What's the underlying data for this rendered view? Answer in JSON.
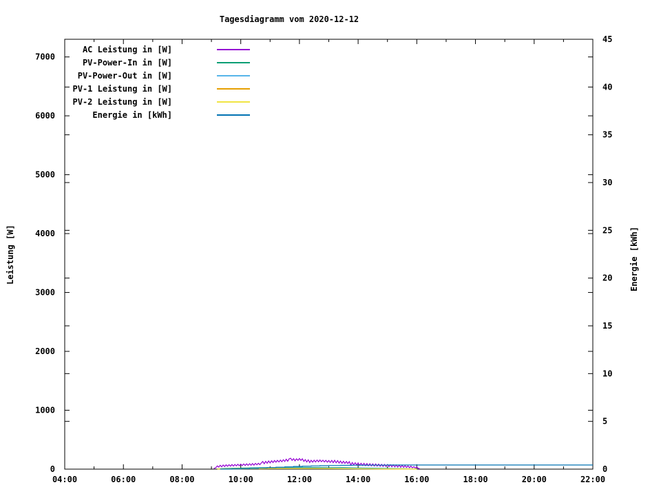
{
  "window": {
    "background": "#ffffff",
    "foreground": "#000000"
  },
  "chart_data": {
    "type": "line",
    "title": "Tagesdiagramm vom 2020-12-12",
    "xlabel": "",
    "ylabel": "Leistung [W]",
    "y2label": "Energie [kWh]",
    "x_axis": {
      "unit": "time",
      "range_hours": [
        4,
        22
      ],
      "major_tick_hours": [
        4,
        6,
        8,
        10,
        12,
        14,
        16,
        18,
        20,
        22
      ],
      "major_tick_labels": [
        "04:00",
        "06:00",
        "08:00",
        "10:00",
        "12:00",
        "14:00",
        "16:00",
        "18:00",
        "20:00",
        "22:00"
      ],
      "minor_tick_hours": [
        5,
        7,
        9,
        11,
        13,
        15,
        17,
        19,
        21
      ]
    },
    "y_axis": {
      "label": "Leistung [W]",
      "range": [
        0,
        7300
      ],
      "ticks": [
        0,
        1000,
        2000,
        3000,
        4000,
        5000,
        6000,
        7000
      ],
      "tick_labels": [
        "0",
        "1000",
        "2000",
        "3000",
        "4000",
        "5000",
        "6000",
        "7000"
      ]
    },
    "y2_axis": {
      "label": "Energie [kWh]",
      "range": [
        0,
        45
      ],
      "ticks": [
        0,
        5,
        10,
        15,
        20,
        25,
        30,
        35,
        40,
        45
      ],
      "tick_labels": [
        "0",
        "5",
        "10",
        "15",
        "20",
        "25",
        "30",
        "35",
        "40",
        "45"
      ]
    },
    "legend": {
      "position": "top-left-inside",
      "rows": 6
    },
    "grid": false,
    "series": [
      {
        "name": "AC Leistung in [W]",
        "color": "#9400d3",
        "axis": "y1",
        "style": "lines",
        "points": [
          [
            9.08,
            10
          ],
          [
            9.15,
            25
          ],
          [
            9.2,
            55
          ],
          [
            9.25,
            35
          ],
          [
            9.3,
            65
          ],
          [
            9.35,
            40
          ],
          [
            9.4,
            70
          ],
          [
            9.45,
            45
          ],
          [
            9.5,
            72
          ],
          [
            9.55,
            48
          ],
          [
            9.6,
            75
          ],
          [
            9.65,
            50
          ],
          [
            9.7,
            78
          ],
          [
            9.75,
            52
          ],
          [
            9.8,
            80
          ],
          [
            9.85,
            55
          ],
          [
            9.9,
            82
          ],
          [
            9.95,
            58
          ],
          [
            10.0,
            85
          ],
          [
            10.05,
            60
          ],
          [
            10.1,
            88
          ],
          [
            10.15,
            62
          ],
          [
            10.2,
            90
          ],
          [
            10.25,
            64
          ],
          [
            10.3,
            92
          ],
          [
            10.35,
            66
          ],
          [
            10.4,
            95
          ],
          [
            10.45,
            68
          ],
          [
            10.5,
            98
          ],
          [
            10.55,
            72
          ],
          [
            10.6,
            100
          ],
          [
            10.65,
            76
          ],
          [
            10.7,
            105
          ],
          [
            10.75,
            130
          ],
          [
            10.8,
            92
          ],
          [
            10.85,
            132
          ],
          [
            10.9,
            100
          ],
          [
            10.95,
            138
          ],
          [
            11.0,
            105
          ],
          [
            11.05,
            142
          ],
          [
            11.1,
            112
          ],
          [
            11.15,
            146
          ],
          [
            11.2,
            118
          ],
          [
            11.25,
            150
          ],
          [
            11.3,
            122
          ],
          [
            11.35,
            155
          ],
          [
            11.4,
            125
          ],
          [
            11.45,
            160
          ],
          [
            11.5,
            130
          ],
          [
            11.55,
            168
          ],
          [
            11.6,
            135
          ],
          [
            11.65,
            176
          ],
          [
            11.7,
            185
          ],
          [
            11.75,
            148
          ],
          [
            11.8,
            178
          ],
          [
            11.85,
            142
          ],
          [
            11.9,
            175
          ],
          [
            11.95,
            150
          ],
          [
            12.0,
            180
          ],
          [
            12.05,
            148
          ],
          [
            12.1,
            176
          ],
          [
            12.15,
            132
          ],
          [
            12.2,
            162
          ],
          [
            12.25,
            120
          ],
          [
            12.3,
            158
          ],
          [
            12.35,
            112
          ],
          [
            12.4,
            150
          ],
          [
            12.45,
            118
          ],
          [
            12.5,
            152
          ],
          [
            12.55,
            122
          ],
          [
            12.6,
            155
          ],
          [
            12.65,
            124
          ],
          [
            12.7,
            156
          ],
          [
            12.75,
            126
          ],
          [
            12.8,
            152
          ],
          [
            12.85,
            122
          ],
          [
            12.9,
            150
          ],
          [
            12.95,
            118
          ],
          [
            13.0,
            146
          ],
          [
            13.05,
            114
          ],
          [
            13.1,
            148
          ],
          [
            13.15,
            110
          ],
          [
            13.2,
            150
          ],
          [
            13.25,
            108
          ],
          [
            13.3,
            145
          ],
          [
            13.35,
            104
          ],
          [
            13.4,
            138
          ],
          [
            13.45,
            100
          ],
          [
            13.5,
            135
          ],
          [
            13.55,
            98
          ],
          [
            13.6,
            130
          ],
          [
            13.65,
            95
          ],
          [
            13.7,
            128
          ],
          [
            13.75,
            68
          ],
          [
            13.8,
            112
          ],
          [
            13.85,
            74
          ],
          [
            13.9,
            108
          ],
          [
            13.95,
            70
          ],
          [
            14.0,
            105
          ],
          [
            14.05,
            66
          ],
          [
            14.1,
            100
          ],
          [
            14.15,
            62
          ],
          [
            14.2,
            98
          ],
          [
            14.25,
            58
          ],
          [
            14.3,
            95
          ],
          [
            14.35,
            56
          ],
          [
            14.4,
            92
          ],
          [
            14.45,
            54
          ],
          [
            14.5,
            90
          ],
          [
            14.55,
            52
          ],
          [
            14.6,
            88
          ],
          [
            14.65,
            50
          ],
          [
            14.7,
            85
          ],
          [
            14.75,
            48
          ],
          [
            14.8,
            82
          ],
          [
            14.85,
            46
          ],
          [
            14.9,
            80
          ],
          [
            14.95,
            44
          ],
          [
            15.0,
            78
          ],
          [
            15.05,
            42
          ],
          [
            15.1,
            75
          ],
          [
            15.15,
            40
          ],
          [
            15.2,
            72
          ],
          [
            15.25,
            38
          ],
          [
            15.3,
            70
          ],
          [
            15.35,
            35
          ],
          [
            15.4,
            68
          ],
          [
            15.45,
            32
          ],
          [
            15.5,
            65
          ],
          [
            15.55,
            30
          ],
          [
            15.6,
            60
          ],
          [
            15.65,
            28
          ],
          [
            15.7,
            55
          ],
          [
            15.75,
            25
          ],
          [
            15.8,
            50
          ],
          [
            15.85,
            22
          ],
          [
            15.9,
            42
          ],
          [
            15.95,
            18
          ],
          [
            16.0,
            35
          ],
          [
            16.05,
            14
          ],
          [
            16.1,
            5
          ]
        ]
      },
      {
        "name": "PV-Power-In in [W]",
        "color": "#009e73",
        "axis": "y1",
        "style": "lines",
        "points": [
          [
            9.2,
            5
          ],
          [
            9.5,
            12
          ],
          [
            10.0,
            18
          ],
          [
            10.5,
            22
          ],
          [
            11.0,
            25
          ],
          [
            11.5,
            28
          ],
          [
            12.0,
            30
          ],
          [
            12.5,
            28
          ],
          [
            13.0,
            26
          ],
          [
            13.5,
            24
          ],
          [
            14.0,
            20
          ],
          [
            14.5,
            16
          ],
          [
            15.0,
            12
          ],
          [
            15.5,
            8
          ],
          [
            16.0,
            4
          ]
        ]
      },
      {
        "name": "PV-Power-Out in [W]",
        "color": "#56b4e9",
        "axis": "y1",
        "style": "lines",
        "points": [
          [
            9.3,
            3
          ],
          [
            10.0,
            10
          ],
          [
            10.5,
            14
          ],
          [
            11.0,
            18
          ],
          [
            11.5,
            20
          ],
          [
            12.0,
            22
          ],
          [
            12.5,
            20
          ],
          [
            13.0,
            18
          ],
          [
            13.5,
            16
          ],
          [
            14.0,
            14
          ],
          [
            14.5,
            10
          ],
          [
            15.0,
            8
          ],
          [
            15.5,
            5
          ],
          [
            16.0,
            2
          ]
        ]
      },
      {
        "name": "PV-1 Leistung in [W]",
        "color": "#e69f00",
        "axis": "y1",
        "style": "lines",
        "points": [
          [
            9.2,
            4
          ],
          [
            10.0,
            8
          ],
          [
            11.0,
            12
          ],
          [
            12.0,
            14
          ],
          [
            13.0,
            12
          ],
          [
            14.0,
            8
          ],
          [
            15.0,
            5
          ],
          [
            16.0,
            2
          ]
        ]
      },
      {
        "name": "PV-2 Leistung in [W]",
        "color": "#f0e442",
        "axis": "y1",
        "style": "lines",
        "points": [
          [
            9.2,
            3
          ],
          [
            10.0,
            6
          ],
          [
            11.0,
            9
          ],
          [
            12.0,
            10
          ],
          [
            13.0,
            9
          ],
          [
            14.0,
            6
          ],
          [
            15.0,
            4
          ],
          [
            16.0,
            2
          ]
        ]
      },
      {
        "name": "Energie in [kWh]",
        "color": "#0072b2",
        "axis": "y2",
        "style": "steps",
        "points": [
          [
            9.3,
            0.0
          ],
          [
            9.7,
            0.02
          ],
          [
            10.0,
            0.05
          ],
          [
            10.3,
            0.08
          ],
          [
            10.6,
            0.12
          ],
          [
            10.9,
            0.16
          ],
          [
            11.2,
            0.2
          ],
          [
            11.5,
            0.24
          ],
          [
            11.8,
            0.28
          ],
          [
            12.1,
            0.31
          ],
          [
            12.4,
            0.34
          ],
          [
            12.7,
            0.36
          ],
          [
            13.0,
            0.38
          ],
          [
            13.4,
            0.4
          ],
          [
            13.8,
            0.41
          ],
          [
            14.3,
            0.42
          ],
          [
            15.0,
            0.43
          ],
          [
            16.0,
            0.43
          ],
          [
            22.0,
            0.43
          ]
        ]
      }
    ]
  }
}
